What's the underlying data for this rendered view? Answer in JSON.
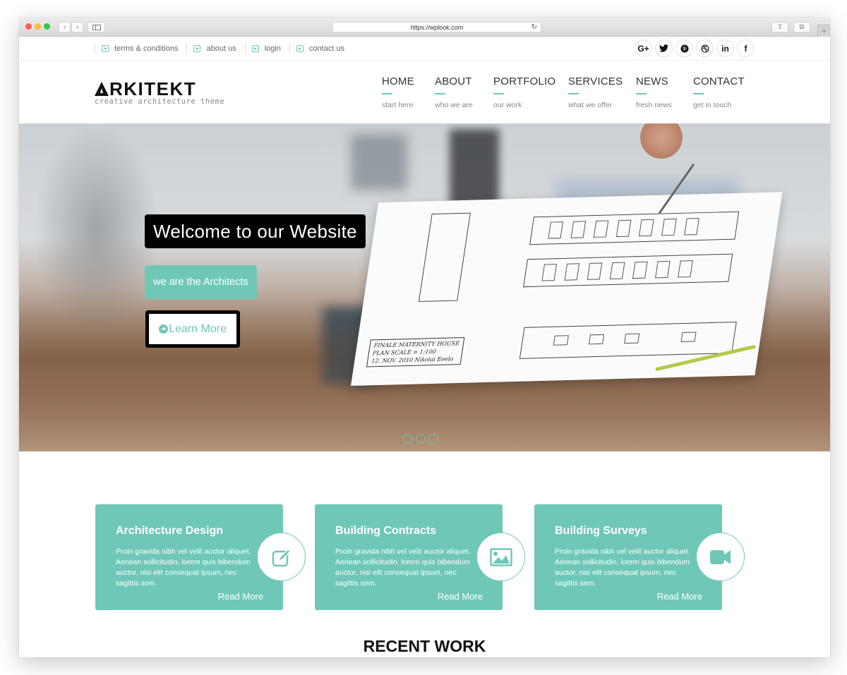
{
  "browser": {
    "url": "https://wplook.com",
    "nav_back": "‹",
    "nav_forward": "›",
    "reload_icon": "↻",
    "share_icon": "⇪",
    "tabs_icon": "⧉",
    "new_tab": "+"
  },
  "topbar": {
    "links": [
      {
        "label": "terms & conditions",
        "icon": "play-square-icon"
      },
      {
        "label": "about us",
        "icon": "play-square-icon"
      },
      {
        "label": "login",
        "icon": "play-square-icon"
      },
      {
        "label": "contact us",
        "icon": "play-square-icon"
      }
    ],
    "socials": [
      {
        "name": "google-plus",
        "glyph": "G+"
      },
      {
        "name": "twitter",
        "glyph": "🐦"
      },
      {
        "name": "pinterest",
        "glyph": "P"
      },
      {
        "name": "dribbble",
        "glyph": "◎"
      },
      {
        "name": "linkedin",
        "glyph": "in"
      },
      {
        "name": "facebook",
        "glyph": "f"
      }
    ]
  },
  "header": {
    "logo_text": "RKITEKT",
    "logo_tagline": "creative architecture theme",
    "nav": [
      {
        "label": "HOME",
        "sub": "start here"
      },
      {
        "label": "ABOUT",
        "sub": "who we are"
      },
      {
        "label": "PORTFOLIO",
        "sub": "our work"
      },
      {
        "label": "SERVICES",
        "sub": "what we offer"
      },
      {
        "label": "NEWS",
        "sub": "fresh news"
      },
      {
        "label": "CONTACT",
        "sub": "get in touch"
      }
    ]
  },
  "hero": {
    "title": "Welcome to our Website",
    "subtitle": "we are the Architects",
    "button_label": "Learn More",
    "button_icon": "➜",
    "blueprint_title": "FINALE MATERNITY HOUSE",
    "blueprint_line2": "PLAN SCALE = 1:100",
    "blueprint_line3": "12. NOV. 2010  Nikolai Eeelo",
    "slides_count": 3,
    "active_slide": 1
  },
  "services": {
    "cards": [
      {
        "title": "Architecture Design",
        "text": "Proin gravida nibh vel velit auctor aliquet. Aenean sollicitudin, lorem quis bibendum auctor, nisi elit consequat ipsum, nec sagittis sem.",
        "link": "Read More",
        "icon": "edit-icon"
      },
      {
        "title": "Building Contracts",
        "text": "Proin gravida nibh vel velit auctor aliquet. Aenean sollicitudin, lorem quis bibendum auctor, nisi elit consequat ipsum, nec sagittis sem.",
        "link": "Read More",
        "icon": "image-icon"
      },
      {
        "title": "Building Surveys",
        "text": "Proin gravida nibh vel velit auctor aliquet. Aenean sollicitudin, lorem quis bibendum auctor, nisi elit consequat ipsum, nec sagittis sem.",
        "link": "Read More",
        "icon": "video-camera-icon"
      }
    ]
  },
  "recent_work": {
    "heading": "RECENT WORK"
  },
  "colors": {
    "accent": "#6fc8b6",
    "dark": "#000000",
    "text": "#333333"
  }
}
